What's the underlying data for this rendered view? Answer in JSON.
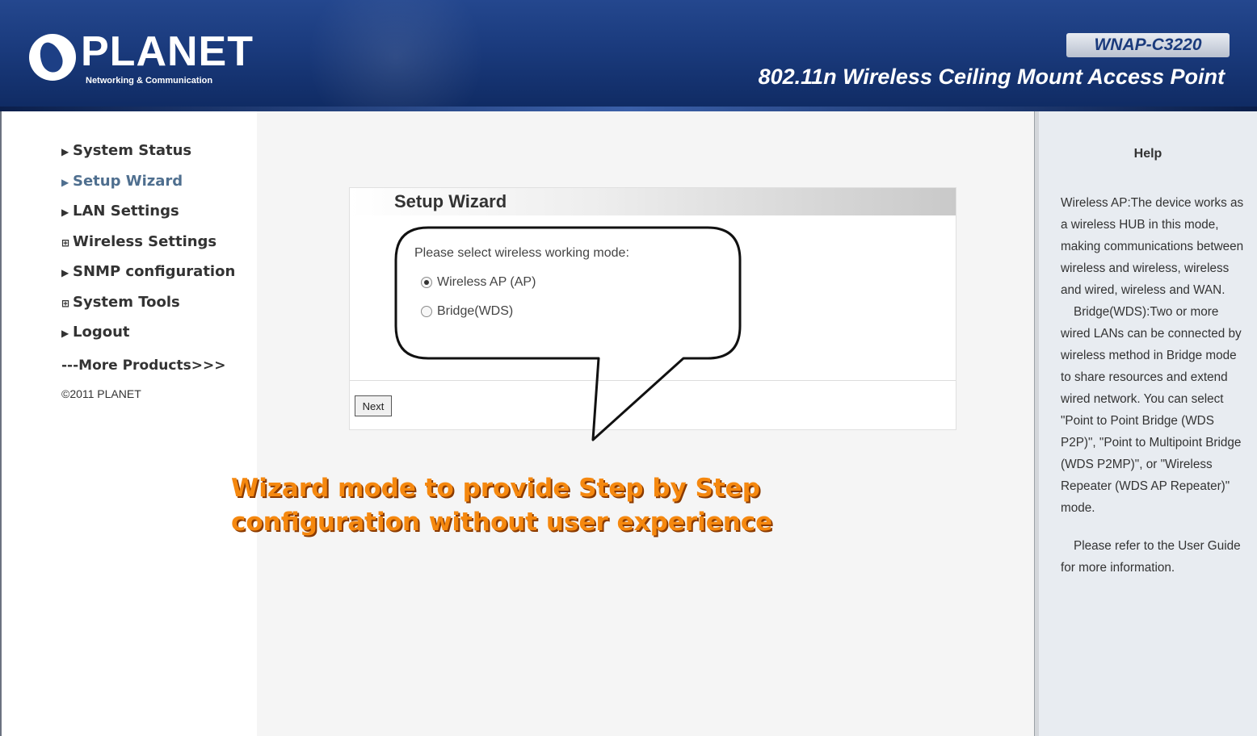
{
  "header": {
    "brand": "PLANET",
    "tagline": "Networking & Communication",
    "model": "WNAP-C3220",
    "product_name": "802.11n Wireless Ceiling Mount Access Point"
  },
  "nav": {
    "items": [
      {
        "marker": "▶",
        "label": "System Status",
        "active": false
      },
      {
        "marker": "▶",
        "label": "Setup Wizard",
        "active": true
      },
      {
        "marker": "▶",
        "label": "LAN Settings",
        "active": false
      },
      {
        "marker": "⊞",
        "label": "Wireless Settings",
        "active": false
      },
      {
        "marker": "▶",
        "label": "SNMP configuration",
        "active": false
      },
      {
        "marker": "⊞",
        "label": "System Tools",
        "active": false
      },
      {
        "marker": "▶",
        "label": "Logout",
        "active": false
      }
    ],
    "more_products": "---More Products>>>",
    "copyright": "©2011 PLANET"
  },
  "wizard": {
    "title": "Setup Wizard",
    "prompt": "Please select wireless working mode:",
    "options": [
      {
        "label": "Wireless AP (AP)",
        "selected": true
      },
      {
        "label": "Bridge(WDS)",
        "selected": false
      }
    ],
    "next_label": "Next"
  },
  "annotation": {
    "line1": "Wizard mode to provide Step by Step",
    "line2": "configuration without user experience"
  },
  "help": {
    "title": "Help",
    "paragraph1": "Wireless AP:The device works as a wireless HUB in this mode, making communications between wireless and wireless, wireless and wired, wireless and WAN.",
    "paragraph2": "Bridge(WDS):Two or more wired LANs can be connected by wireless method in Bridge mode to share resources and extend wired network. You can select \"Point to Point Bridge (WDS P2P)\", \"Point to Multipoint Bridge (WDS P2MP)\", or \"Wireless Repeater (WDS AP Repeater)\" mode.",
    "paragraph3": "Please refer to the User Guide for more information."
  },
  "colors": {
    "header_blue": "#1a3a7c",
    "annotation_orange": "#f5880f",
    "help_bg": "#e8ecf1",
    "active_nav": "#4f6f8f"
  }
}
